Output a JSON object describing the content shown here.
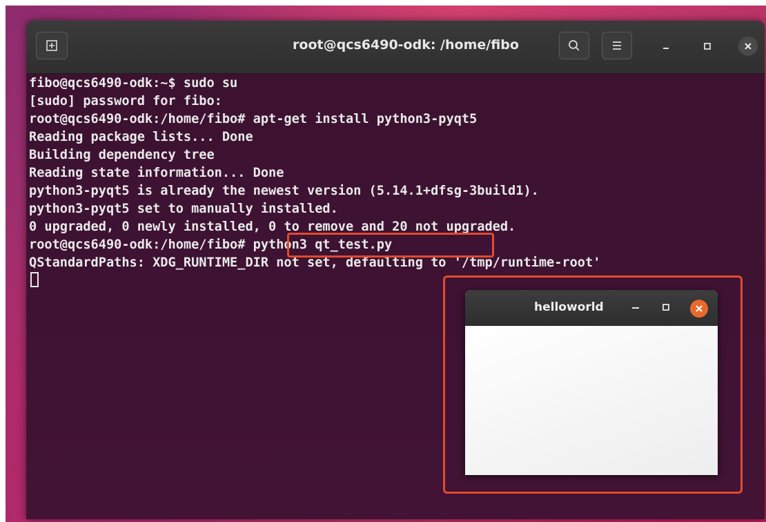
{
  "terminal": {
    "title": "root@qcs6490-odk: /home/fibo",
    "icons": {
      "new_tab": "new-tab-icon",
      "search": "search-icon",
      "menu": "hamburger-menu-icon",
      "minimize": "minimize-icon",
      "maximize": "maximize-icon",
      "close": "close-icon"
    },
    "lines": [
      "fibo@qcs6490-odk:~$ sudo su",
      "[sudo] password for fibo:",
      "root@qcs6490-odk:/home/fibo# apt-get install python3-pyqt5",
      "Reading package lists... Done",
      "Building dependency tree",
      "Reading state information... Done",
      "python3-pyqt5 is already the newest version (5.14.1+dfsg-3build1).",
      "python3-pyqt5 set to manually installed.",
      "0 upgraded, 0 newly installed, 0 to remove and 20 not upgraded.",
      "root@qcs6490-odk:/home/fibo# python3 qt_test.py",
      "QStandardPaths: XDG_RUNTIME_DIR not set, defaulting to '/tmp/runtime-root'"
    ]
  },
  "qt_window": {
    "title": "helloworld",
    "icons": {
      "minimize": "minimize-icon",
      "maximize": "maximize-icon",
      "close": "close-icon"
    }
  },
  "colors": {
    "terminal_bg": "#3f1233",
    "terminal_text": "#eaeaea",
    "annotation": "#e04b2f",
    "qt_close": "#e9692c"
  }
}
